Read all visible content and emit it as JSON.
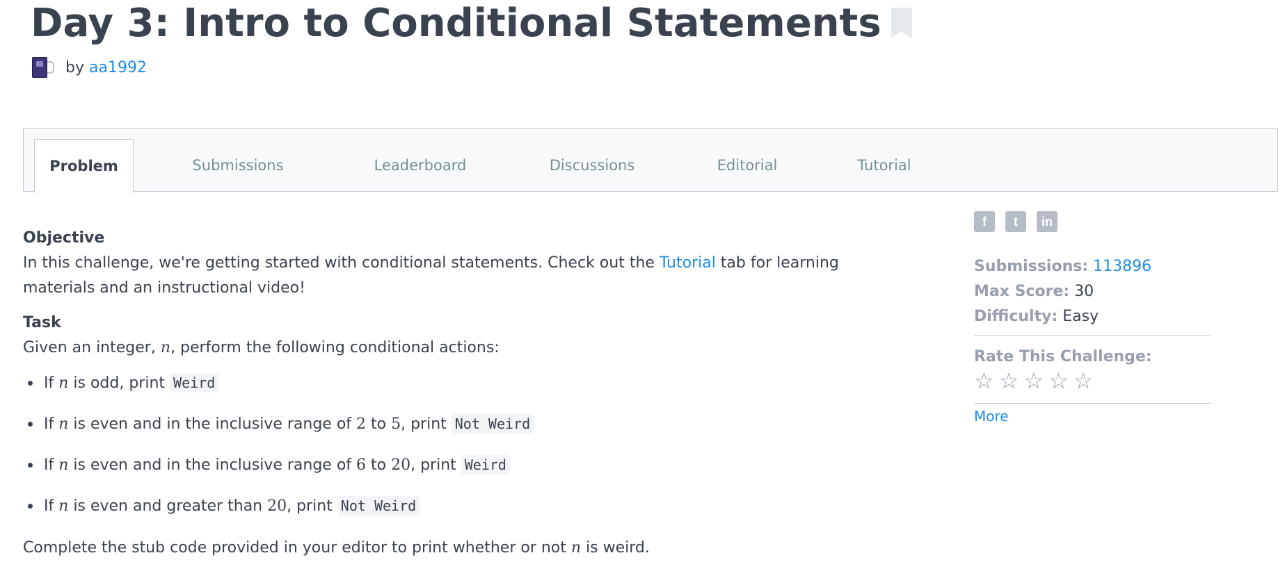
{
  "header": {
    "title": "Day 3: Intro to Conditional Statements",
    "by_label": "by",
    "author": "aa1992"
  },
  "tabs": [
    {
      "label": "Problem",
      "active": true
    },
    {
      "label": "Submissions"
    },
    {
      "label": "Leaderboard"
    },
    {
      "label": "Discussions"
    },
    {
      "label": "Editorial"
    },
    {
      "label": "Tutorial"
    }
  ],
  "problem": {
    "objective_title": "Objective",
    "objective_pre": "In this challenge, we're getting started with conditional statements. Check out the ",
    "objective_link": "Tutorial",
    "objective_post": " tab for learning materials and an instructional video!",
    "task_title": "Task",
    "task_pre": "Given an integer, ",
    "var": "n",
    "task_post": ", perform the following conditional actions:",
    "rules": [
      {
        "pre": "If ",
        "var": "n",
        "mid": " is odd, print ",
        "code": "Weird"
      },
      {
        "pre": "If ",
        "var": "n",
        "mid": " is even and in the inclusive range of ",
        "a": "2",
        "to": " to ",
        "b": "5",
        "end": ", print ",
        "code": "Not Weird"
      },
      {
        "pre": "If ",
        "var": "n",
        "mid": " is even and in the inclusive range of ",
        "a": "6",
        "to": " to ",
        "b": "20",
        "end": ", print ",
        "code": "Weird"
      },
      {
        "pre": "If ",
        "var": "n",
        "mid": " is even and greater than ",
        "a": "20",
        "end": ", print ",
        "code": "Not Weird"
      }
    ],
    "complete_pre": "Complete the stub code provided in your editor to print whether or not ",
    "complete_post": " is weird."
  },
  "sidebar": {
    "social": [
      {
        "icon": "facebook-icon",
        "glyph": "f"
      },
      {
        "icon": "twitter-icon",
        "glyph": "t"
      },
      {
        "icon": "linkedin-icon",
        "glyph": "in"
      }
    ],
    "submissions_label": "Submissions:",
    "submissions_value": "113896",
    "max_score_label": "Max Score:",
    "max_score_value": "30",
    "difficulty_label": "Difficulty:",
    "difficulty_value": "Easy",
    "rate_label": "Rate This Challenge:",
    "rating_stars_filled": 0,
    "rating_stars_total": 5,
    "more_label": "More"
  }
}
